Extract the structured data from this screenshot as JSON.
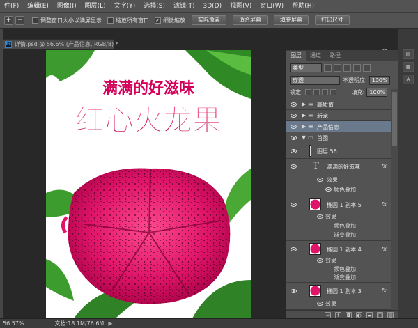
{
  "menu": [
    "件(F)",
    "编辑(E)",
    "图像(I)",
    "图层(L)",
    "文字(Y)",
    "选择(S)",
    "滤镜(T)",
    "3D(D)",
    "视图(V)",
    "窗口(W)",
    "帮助(H)"
  ],
  "options": {
    "zoom_in_icon": "zoom-in-icon",
    "zoom_out_icon": "zoom-out-icon",
    "resize_windows": {
      "label": "调整窗口大小以满屏显示",
      "checked": false
    },
    "zoom_all": {
      "label": "缩放所有窗口",
      "checked": false
    },
    "scrubby_zoom": {
      "label": "细微缩放",
      "checked": true
    },
    "buttons": [
      "实际像素",
      "适合屏幕",
      "填充屏幕",
      "打印尺寸"
    ]
  },
  "document": {
    "ps_badge": "Ps",
    "tab_title": "详情.psd @ 56.6% (产品信息, RGB/8) *"
  },
  "artwork": {
    "tagline": "满满的好滋味",
    "title": "红心火龙果",
    "brand_color": "#d4005a",
    "leaf_color": "#2e8b2e",
    "fruit_color": "#e0156a"
  },
  "status": {
    "zoom": "56.57%",
    "doc": "文档:18.1M/76.6M"
  },
  "panel": {
    "tabs": [
      "图层",
      "通道",
      "路径"
    ],
    "filter": {
      "kind": "类型"
    },
    "blend": {
      "mode": "穿透",
      "opacity_label": "不透明度:",
      "opacity": "100%"
    },
    "lock": {
      "label": "锁定:",
      "fill_label": "填充:",
      "fill": "100%"
    },
    "groups": [
      {
        "name": "高质值"
      },
      {
        "name": "新宠"
      },
      {
        "name": "产品信息"
      },
      {
        "name": "首图"
      }
    ],
    "layer56": "图层 56",
    "text_layer": {
      "name": "满满的好滋味",
      "effects": "效果",
      "sub": [
        "颜色叠加"
      ]
    },
    "ellipses": [
      {
        "name": "椭圆 1 副本 5",
        "effects": "效果",
        "sub": [
          "颜色叠加",
          "渐变叠加"
        ]
      },
      {
        "name": "椭圆 1 副本 4",
        "effects": "效果",
        "sub": [
          "颜色叠加",
          "渐变叠加"
        ]
      },
      {
        "name": "椭圆 1 副本 3",
        "effects": "效果"
      }
    ],
    "fx": "fx"
  }
}
